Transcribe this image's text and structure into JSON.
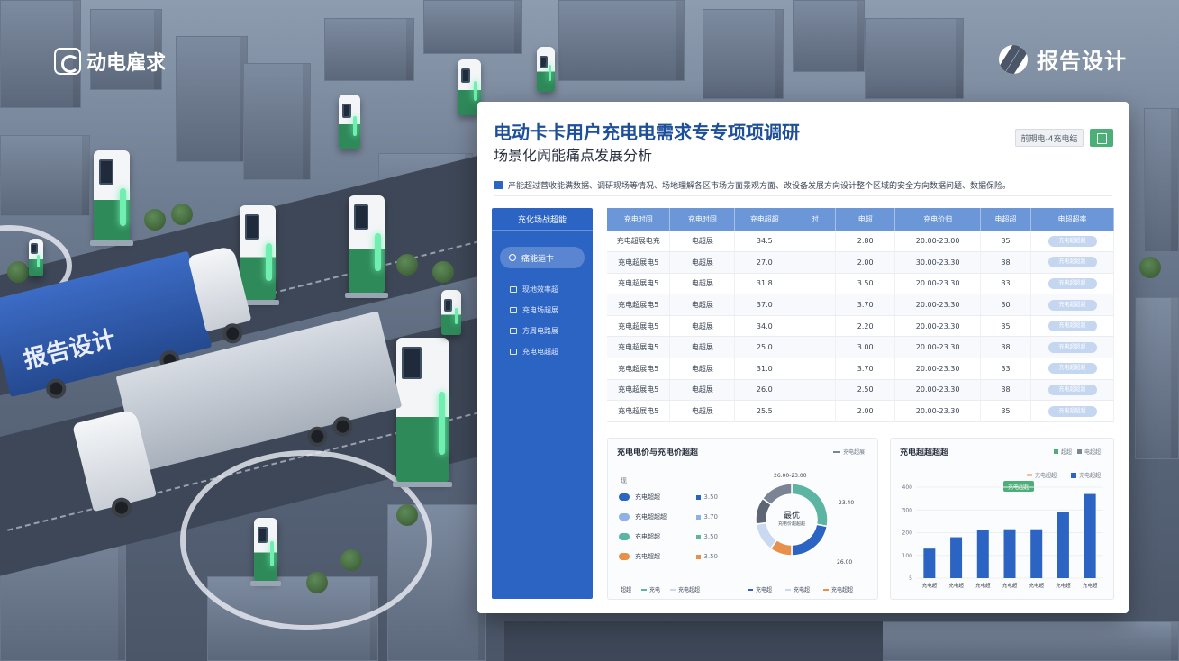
{
  "brand": {
    "left_name": "动电雇求",
    "right_name": "报告设计",
    "truck_label": "报告设计"
  },
  "panel": {
    "title": "电动卡卡用户充电电需求专专项项调研",
    "subtitle": "场景化闶能痛点发展分析",
    "button_label": "前期电-4充电结",
    "description": "产能超过营收能满数据、调研现场等情况、场地理解各区市场方面景观方面、改设备发展方向设计整个区域的安全方向数据问题、数据保险。"
  },
  "sidebar": {
    "header": "充化场战超能",
    "active_item": "痛能运卞",
    "items": [
      "现地效率超",
      "充电场超展",
      "方周电路展",
      "充电电超超"
    ]
  },
  "table": {
    "headers": [
      "充电时间",
      "充电时间",
      "充电超超",
      "时",
      "电超",
      "充电价归",
      "电超超",
      "电超超率"
    ],
    "rows": [
      {
        "name": "充电超展电充",
        "type": "电超展",
        "v1": "34.5",
        "v2": "2.80",
        "range": "20.00-23.00",
        "n": "35",
        "pill": "充电超超超"
      },
      {
        "name": "充电超展电5",
        "type": "电超展",
        "v1": "27.0",
        "v2": "2.00",
        "range": "30.00-23.30",
        "n": "38",
        "pill": "充电超超超"
      },
      {
        "name": "充电超展电5",
        "type": "电超展",
        "v1": "31.8",
        "v2": "3.50",
        "range": "20.00-23.30",
        "n": "33",
        "pill": "充电超超超"
      },
      {
        "name": "充电超展电5",
        "type": "电超展",
        "v1": "37.0",
        "v2": "3.70",
        "range": "20.00-23.30",
        "n": "30",
        "pill": "充电超超超"
      },
      {
        "name": "充电超展电5",
        "type": "电超展",
        "v1": "34.0",
        "v2": "2.20",
        "range": "20.00-23.30",
        "n": "35",
        "pill": "充电超超超"
      },
      {
        "name": "充电超展电5",
        "type": "电超展",
        "v1": "25.0",
        "v2": "3.00",
        "range": "20.00-23.30",
        "n": "38",
        "pill": "充电超超超"
      },
      {
        "name": "充电超展电5",
        "type": "电超展",
        "v1": "31.0",
        "v2": "3.70",
        "range": "20.00-23.30",
        "n": "33",
        "pill": "充电超超超"
      },
      {
        "name": "充电超展电5",
        "type": "电超展",
        "v1": "26.0",
        "v2": "2.50",
        "range": "20.00-23.30",
        "n": "38",
        "pill": "充电超超超"
      },
      {
        "name": "充电超展电5",
        "type": "电超展",
        "v1": "25.5",
        "v2": "2.00",
        "range": "20.00-23.30",
        "n": "35",
        "pill": "充电超超超"
      }
    ]
  },
  "donut_card": {
    "title": "充电电价与充电价超超",
    "tag": "充电超展",
    "legend_head": "现",
    "legend": [
      {
        "label": "充电超超",
        "value": "3.50",
        "color": "#2c64c4"
      },
      {
        "label": "充电超超超",
        "value": "3.70",
        "color": "#8eb2e6"
      },
      {
        "label": "充电超超",
        "value": "3.50",
        "color": "#5bb5a2"
      },
      {
        "label": "充电超超",
        "value": "3.50",
        "color": "#e8904a"
      }
    ],
    "center_top": "最优",
    "center_bottom": "充电价超超超",
    "top_label": "26.00-23.00",
    "right_label": "23.40",
    "bottom_right_label": "26.00",
    "foot_left": [
      "超超",
      "充电",
      "充电超超"
    ],
    "foot_right": [
      "充电超",
      "充电超",
      "充电超超"
    ],
    "chart_data": {
      "type": "pie",
      "slices": [
        {
          "value": 28,
          "color": "#5bb5a2"
        },
        {
          "value": 22,
          "color": "#2c64c4"
        },
        {
          "value": 10,
          "color": "#e8904a"
        },
        {
          "value": 13,
          "color": "#c9d9f2"
        },
        {
          "value": 12,
          "color": "#5d6673"
        },
        {
          "value": 15,
          "color": "#7a8494"
        }
      ]
    }
  },
  "bar_card": {
    "title": "充电超超超超",
    "tag_a": "超超",
    "tag_b": "电超超",
    "legend_a": "充电超超",
    "legend_b": "充电超超",
    "badge": "充电超超",
    "chart_data": {
      "type": "bar",
      "categories": [
        "充电超",
        "充电超",
        "充电超",
        "充电超",
        "充电超",
        "充电超",
        "充电超"
      ],
      "values": [
        130,
        180,
        210,
        215,
        215,
        290,
        370
      ],
      "yticks": [
        "400",
        "300",
        "200",
        "100",
        "5"
      ],
      "ylim": [
        0,
        400
      ],
      "color": "#2c64c4"
    }
  }
}
